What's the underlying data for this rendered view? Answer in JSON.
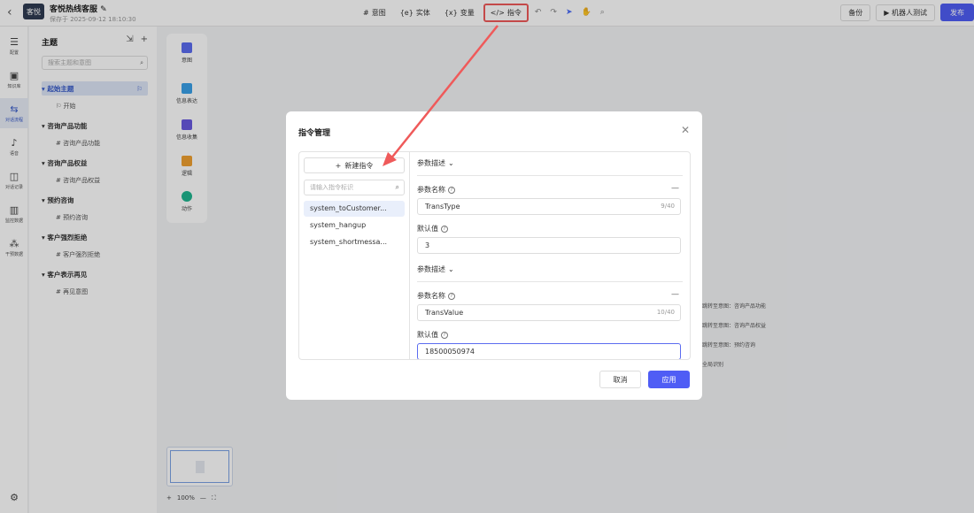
{
  "app": {
    "logo_text": "客悦",
    "title": "客悦热线客服",
    "saved_at": "保存于 2025-09-12 18:10:30"
  },
  "toolbar": {
    "intent": "意图",
    "entity": "实体",
    "variable": "变量",
    "instruction": "指令"
  },
  "topright": {
    "backup": "备份",
    "robot_test": "机器人测试",
    "publish": "发布"
  },
  "leftnav": [
    "配置",
    "知识库",
    "对话流程",
    "语音",
    "对话记录",
    "监控数据",
    "干预数据"
  ],
  "topics": {
    "title": "主题",
    "search_placeholder": "搜索主题和意图",
    "rows": [
      "起始主题",
      "开始",
      "咨询产品功能",
      "咨询产品功能",
      "咨询产品权益",
      "咨询产品权益",
      "预约咨询",
      "预约咨询",
      "客户强烈拒绝",
      "客户强烈拒绝",
      "客户表示再见",
      "再见意图"
    ]
  },
  "palette": [
    "意图",
    "信息表达",
    "信息收集",
    "逻辑",
    "动作"
  ],
  "background": {
    "jump1": "跳转至意图：咨询产品功能",
    "jump2": "跳转至意图：咨询产品权益",
    "jump3": "跳转至意图：预约咨询",
    "global": "全局识别"
  },
  "zoom": {
    "level": "100%"
  },
  "modal": {
    "title": "指令管理",
    "new_instruction": "新建指令",
    "search_placeholder": "请输入指令标识",
    "commands": [
      "system_toCustomer...",
      "system_hangup",
      "system_shortmessa..."
    ],
    "param_desc_label": "参数描述",
    "param_name_label": "参数名称",
    "default_label": "默认值",
    "param1": {
      "name": "TransType",
      "count": "9/40",
      "default": "3"
    },
    "param2": {
      "name": "TransValue",
      "count": "10/40",
      "default": "18500050974"
    },
    "cancel": "取消",
    "apply": "应用"
  },
  "colors": {
    "primary": "#4f5df5",
    "highlight": "#f05a5a",
    "active_nav": "#3659c9"
  }
}
